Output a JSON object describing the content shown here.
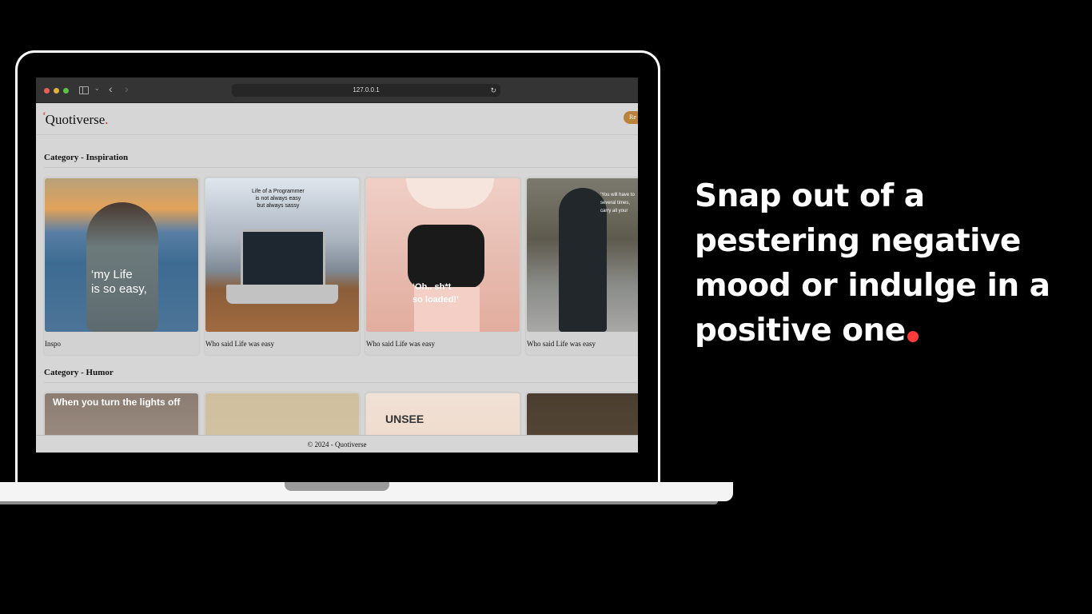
{
  "headline": {
    "text": "Snap out of a pestering negative mood or indulge in a positive one",
    "accent_color": "#ff3b3b"
  },
  "browser": {
    "url": "127.0.0.1",
    "reload_icon": "↻",
    "back_icon": "‹",
    "forward_icon": "›",
    "sidebar_chevron": "⌄"
  },
  "site": {
    "logo": {
      "mark": "‘",
      "name": "Quotiverse",
      "dot": "."
    },
    "register_label": "Re",
    "brand_color": "#b9823a"
  },
  "categories": [
    {
      "title": "Category - Inspiration",
      "cards": [
        {
          "caption": "Inspo",
          "overlay": "‘my Life\nis so easy,",
          "icon": "photo"
        },
        {
          "caption": "Who said Life was easy",
          "overlay": "Life of a Programmer\nis not always easy\nbut always sassy",
          "icon": "photo"
        },
        {
          "caption": "Who said Life was easy",
          "overlay": "‘Oh.. sh*t\nso loaded!’",
          "icon": "photo"
        },
        {
          "caption": "Who said Life was easy",
          "overlay": "‘You will have to\nseveral times,\ncarry all your",
          "icon": "photo"
        }
      ]
    },
    {
      "title": "Category - Humor",
      "cards": [
        {
          "caption": "",
          "overlay": "When you turn the lights off",
          "icon": "photo"
        },
        {
          "caption": "",
          "overlay": "",
          "icon": "photo"
        },
        {
          "caption": "",
          "overlay": "UNSEE",
          "icon": "photo"
        },
        {
          "caption": "",
          "overlay": "",
          "icon": "photo"
        }
      ]
    }
  ],
  "footer": {
    "text": "© 2024 - Quotiverse"
  }
}
